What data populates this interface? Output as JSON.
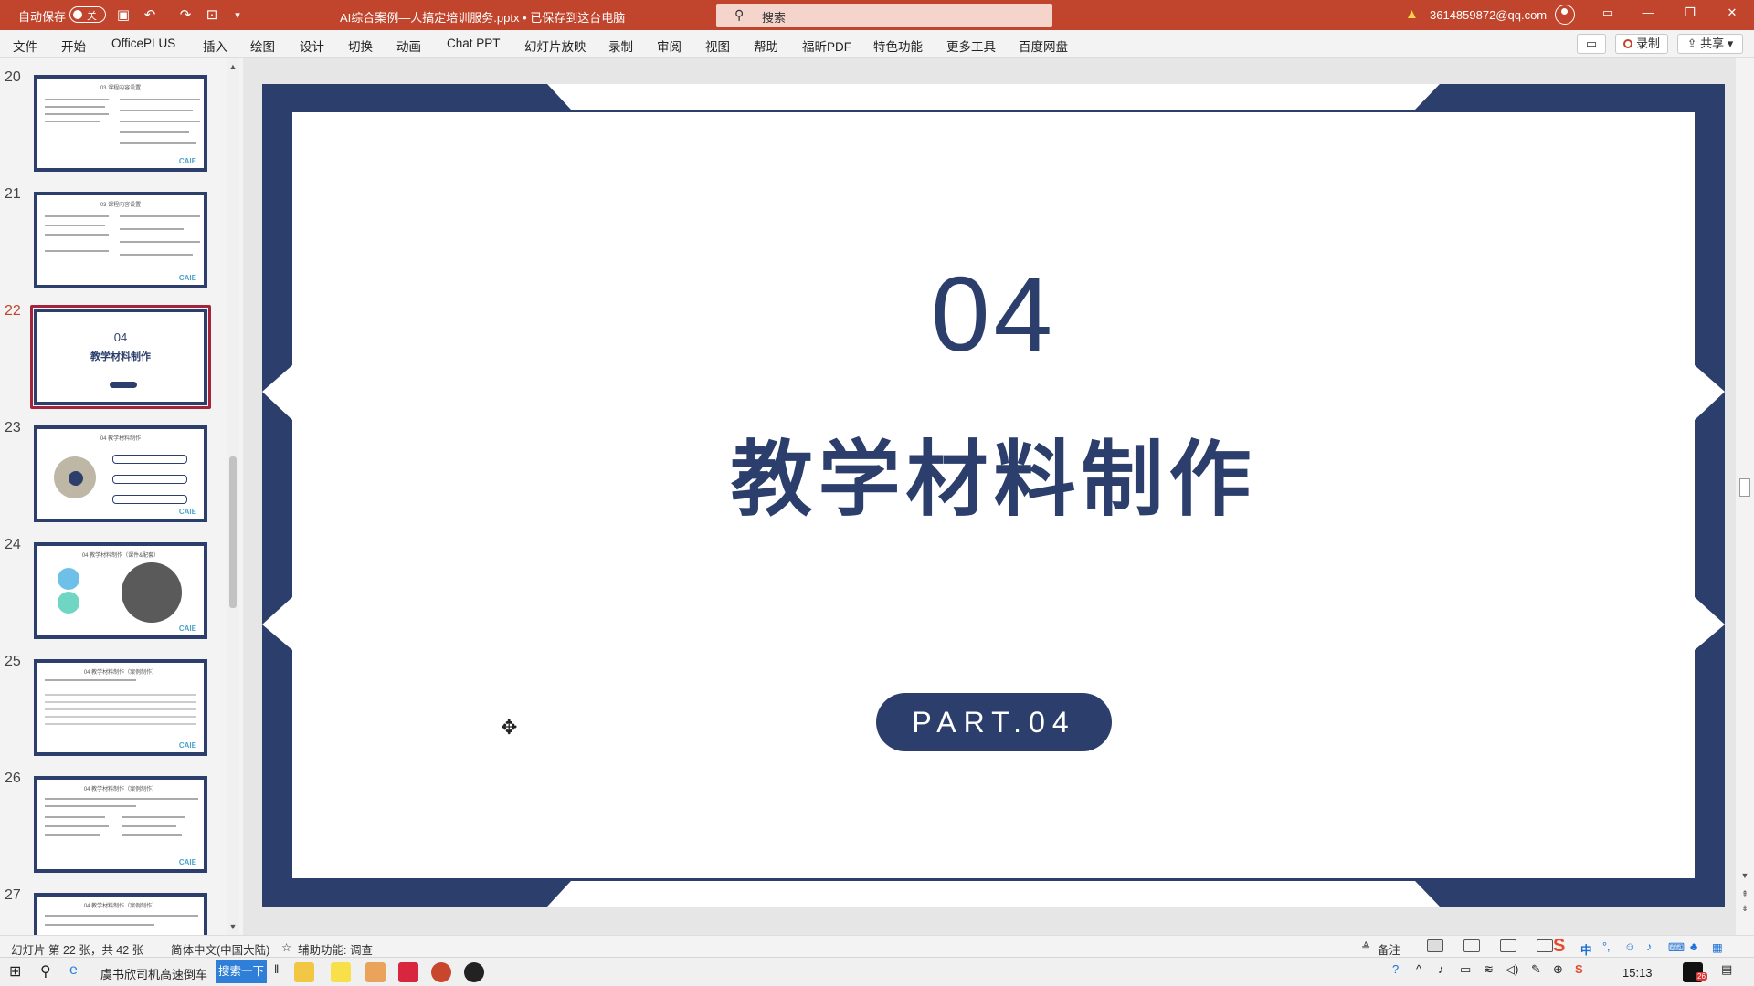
{
  "titlebar": {
    "autosave_label": "自动保存",
    "autosave_state": "关",
    "document_title": "AI综合案例—人搞定培训服务.pptx • 已保存到这台电脑",
    "search_placeholder": "搜索",
    "warning_icon": "warning-icon",
    "account": "3614859872@qq.com"
  },
  "ribbon": {
    "tabs": [
      "文件",
      "开始",
      "OfficePLUS",
      "插入",
      "绘图",
      "设计",
      "切换",
      "动画",
      "Chat PPT",
      "幻灯片放映",
      "录制",
      "审阅",
      "视图",
      "帮助",
      "福昕PDF",
      "特色功能",
      "更多工具",
      "百度网盘"
    ],
    "record_label": "录制",
    "share_label": "共享"
  },
  "thumbnails": [
    {
      "num": "20",
      "title": "03 课程内容设置"
    },
    {
      "num": "21",
      "title": "03 课程内容设置"
    },
    {
      "num": "22",
      "big_num": "04",
      "big_title": "教学材料制作",
      "selected": true
    },
    {
      "num": "23",
      "title": "04 教学材料制作"
    },
    {
      "num": "24",
      "title": "04 教学材料制作（课件&配套）"
    },
    {
      "num": "25",
      "title": "04 教学材料制作（案例制作）"
    },
    {
      "num": "26",
      "title": "04 教学材料制作（案例制作）"
    },
    {
      "num": "27",
      "title": "04 教学材料制作（案例制作）"
    }
  ],
  "thumb_brand": "CAIE",
  "slide": {
    "number": "04",
    "title": "教学材料制作",
    "pill": "PART.04",
    "accent_color": "#2c3e6b"
  },
  "statusbar": {
    "slide_info": "幻灯片 第 22 张，共 42 张",
    "language": "简体中文(中国大陆)",
    "accessibility": "辅助功能: 调查",
    "notes": "备注"
  },
  "taskbar": {
    "news": "虞书欣司机高速倒车",
    "search_button": "搜索一下",
    "ime": "中",
    "time": "15:13",
    "notification_count": "26"
  }
}
